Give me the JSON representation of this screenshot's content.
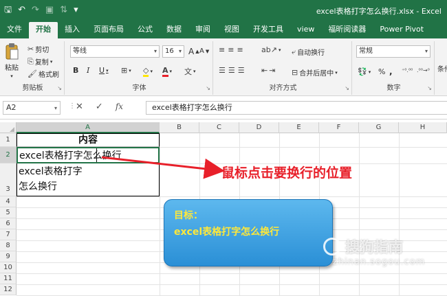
{
  "window": {
    "title": "excel表格打字怎么换行.xlsx - Excel"
  },
  "qat": {
    "save_icon": "save-icon",
    "undo_icon": "undo-icon",
    "redo_icon": "redo-icon",
    "preview_icon": "print-preview-icon",
    "sort_icon": "sort-icon",
    "customize_icon": "customize-qat-icon"
  },
  "tabs": [
    "文件",
    "开始",
    "插入",
    "页面布局",
    "公式",
    "数据",
    "审阅",
    "视图",
    "开发工具",
    "view",
    "福昕阅读器",
    "Power Pivot"
  ],
  "active_tab": "开始",
  "ribbon": {
    "clipboard": {
      "paste": "粘贴",
      "cut": "剪切",
      "copy": "复制",
      "format_painter": "格式刷",
      "label": "剪贴板"
    },
    "font": {
      "font_name": "等线",
      "font_size": "16",
      "bold": "B",
      "italic": "I",
      "underline": "U",
      "grow": "A",
      "shrink": "A",
      "label": "字体"
    },
    "alignment": {
      "wrap_text": "自动换行",
      "merge_center": "合并后居中",
      "label": "对齐方式"
    },
    "number": {
      "format": "常规",
      "percent": "%",
      "comma": ",",
      "label": "数字"
    },
    "styles": {
      "conditional": "条件"
    }
  },
  "formula_bar": {
    "name_box": "A2",
    "cancel": "✕",
    "enter": "✓",
    "fx": "fx",
    "content": "excel表格打字怎么换行"
  },
  "columns": [
    "A",
    "B",
    "C",
    "D",
    "E",
    "F",
    "G",
    "H"
  ],
  "rows": [
    "1",
    "2",
    "3",
    "4",
    "5",
    "6",
    "7",
    "8",
    "9",
    "10",
    "11",
    "12"
  ],
  "cells": {
    "A1": "内容",
    "A2": "excel表格打字怎么换行",
    "A3_line1": "excel表格打字",
    "A3_line2": "怎么换行"
  },
  "annotation": {
    "callout": "鼠标点击要换行的位置",
    "goal_title": "目标：",
    "goal_text": "excel表格打字怎么换行",
    "callout_color": "#e8202a",
    "goal_text_color": "#ffe83a"
  },
  "watermark": {
    "name": "搜狗指南",
    "url": "zhinan.sogou.com"
  },
  "colors": {
    "excel_green": "#217346",
    "ribbon_bg": "#f3f3f3"
  }
}
